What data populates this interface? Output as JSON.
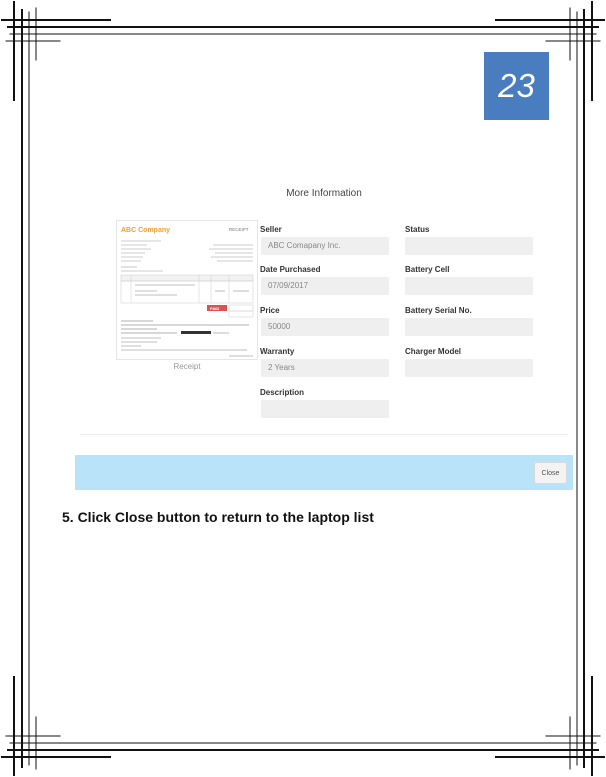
{
  "page_number": "23",
  "modal": {
    "title": "More Information",
    "receipt_caption": "Receipt",
    "receipt_thumb": {
      "company": "ABC Company",
      "doc_type": "RECEIPT",
      "highlight_label": "PAID"
    },
    "fields": {
      "seller": {
        "label": "Seller",
        "value": "ABC Comapany Inc."
      },
      "date_purchased": {
        "label": "Date Purchased",
        "value": "07/09/2017"
      },
      "price": {
        "label": "Price",
        "value": "50000"
      },
      "warranty": {
        "label": "Warranty",
        "value": "2 Years"
      },
      "description": {
        "label": "Description",
        "value": ""
      },
      "status": {
        "label": "Status",
        "value": ""
      },
      "battery_cell": {
        "label": "Battery Cell",
        "value": ""
      },
      "battery_serial": {
        "label": "Battery Serial No.",
        "value": ""
      },
      "charger_model": {
        "label": "Charger Model",
        "value": ""
      }
    },
    "close_label": "Close"
  },
  "instruction": "5. Click Close button to return to the laptop list",
  "colors": {
    "page_number_bg": "#4a7dbf",
    "footer_bar": "#b9e3f8",
    "field_bg": "#efefef",
    "receipt_accent": "#f0a030",
    "receipt_paid": "#e05050"
  }
}
